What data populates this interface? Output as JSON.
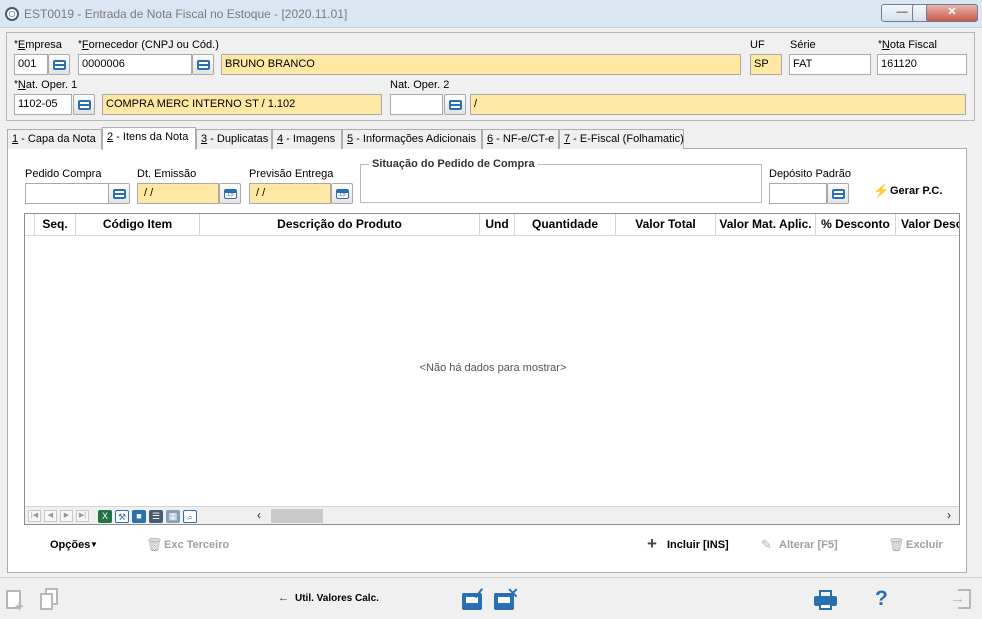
{
  "window": {
    "title": "EST0019 - Entrada de Nota Fiscal no Estoque - [2020.11.01]",
    "min_label": "—",
    "max_label": "□",
    "close_label": "✕"
  },
  "header": {
    "empresa": {
      "label_req": "*",
      "label_u": "E",
      "label_rest": "mpresa",
      "value": "001"
    },
    "fornecedor": {
      "label_req": "*",
      "label_u": "F",
      "label_rest": "ornecedor (CNPJ ou Cód.)",
      "code": "0000006",
      "name": "BRUNO BRANCO"
    },
    "uf": {
      "label": "UF",
      "value": "SP"
    },
    "serie": {
      "label": "Série",
      "value": "FAT"
    },
    "nota_fiscal": {
      "label_req": "*",
      "label_u": "N",
      "label_rest": "ota Fiscal",
      "value": "161120"
    },
    "nat_oper1": {
      "label_req": "*",
      "label_u": "N",
      "label_rest": "at. Oper. 1",
      "code": "1102-05",
      "description": "COMPRA MERC INTERNO ST / 1.102"
    },
    "nat_oper2": {
      "label": "Nat. Oper. 2",
      "code": "",
      "description": "/"
    }
  },
  "tabs": [
    {
      "num": "1",
      "label": " - Capa da Nota"
    },
    {
      "num": "2",
      "label": " - Itens da Nota"
    },
    {
      "num": "3",
      "label": " - Duplicatas"
    },
    {
      "num": "4",
      "label": " - Imagens"
    },
    {
      "num": "5",
      "label": " - Informações Adicionais"
    },
    {
      "num": "6",
      "label": " - NF-e/CT-e"
    },
    {
      "num": "7",
      "label": " - E-Fiscal (Folhamatic)"
    }
  ],
  "items_tab": {
    "pedido_compra": {
      "label": "Pedido Compra",
      "value": ""
    },
    "dt_emissao": {
      "label": "Dt. Emissão",
      "value": " / /"
    },
    "previsao_entrega": {
      "label": "Previsão Entrega",
      "value": " / /"
    },
    "situacao_title": "Situação do Pedido de Compra",
    "deposito_padrao": {
      "label": "Depósito Padrão",
      "value": ""
    },
    "gerar_pc": "Gerar P.C."
  },
  "grid": {
    "columns": [
      "Seq.",
      "Código Item",
      "Descrição do Produto",
      "Und",
      "Quantidade",
      "Valor Total",
      "Valor Mat. Aplic.",
      "% Desconto",
      "Valor Desc"
    ],
    "empty_message": "<Não há dados para mostrar>"
  },
  "actions": {
    "opcoes": "Opções",
    "exc_terceiro": "Exc Terceiro",
    "incluir": "Incluir [INS]",
    "alterar": "Alterar [F5]",
    "excluir": "Excluir"
  },
  "footer": {
    "util_valores": "Util. Valores Calc."
  },
  "colors": {
    "required_field": "#ffe8a3",
    "accent_blue": "#2a6fb0"
  }
}
